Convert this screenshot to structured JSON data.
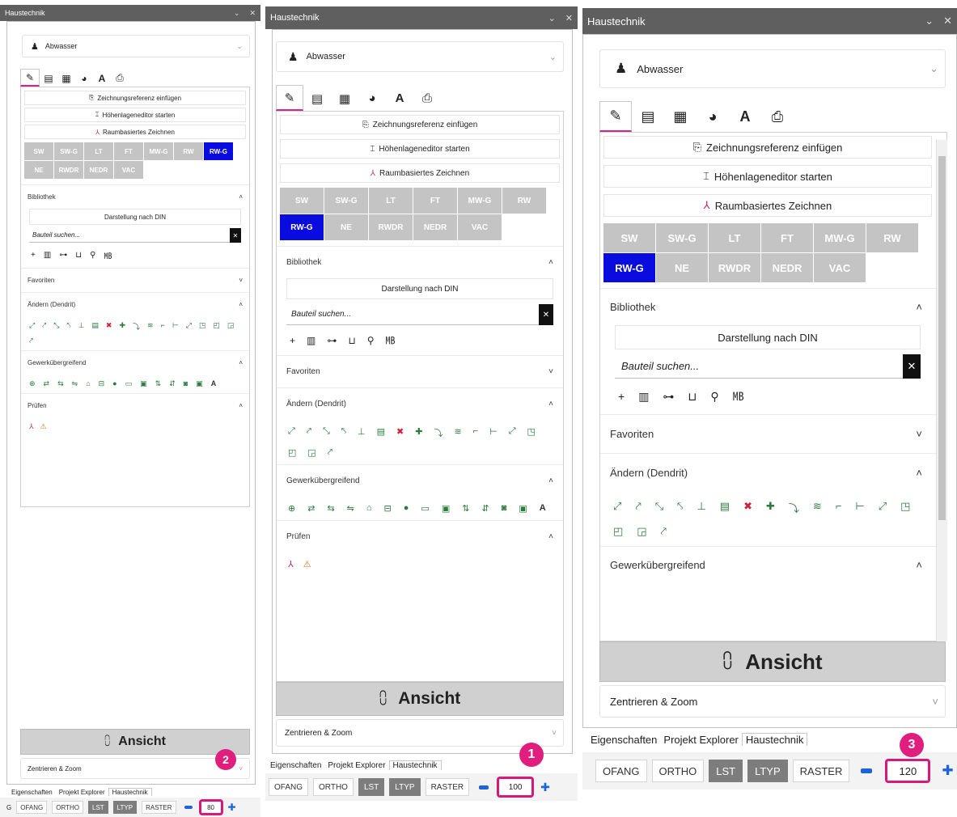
{
  "panel_title": "Haustechnik",
  "window_controls": {
    "chevron": "⌄",
    "close": "✕"
  },
  "system_dropdown": {
    "value": "Abwasser",
    "icon": "toilet-icon"
  },
  "tab_icons": [
    "pencil-icon",
    "list-icon",
    "calculator-icon",
    "pie-chart-icon",
    "text-style-icon",
    "print-icon"
  ],
  "actions": {
    "drawing_reference": "Zeichnungsreferenz einfügen",
    "height_editor": "Höhenlageneditor starten",
    "room_drawing": "Raumbasiertes Zeichnen"
  },
  "system_buttons_row1": [
    "SW",
    "SW-G",
    "LT",
    "FT",
    "MW-G",
    "RW"
  ],
  "system_buttons_row2": [
    "RW-G",
    "NE",
    "RWDR",
    "NEDR",
    "VAC"
  ],
  "selected_system": "RW-G",
  "sections": {
    "bibliothek": "Bibliothek",
    "favoriten": "Favoriten",
    "aendern": "Ändern (Dendrit)",
    "gewerk": "Gewerkübergreifend",
    "pruefen": "Prüfen"
  },
  "library": {
    "display_mode": "Darstellung nach DIN",
    "search_placeholder": "Bauteil suchen...",
    "clear_label": "✕"
  },
  "library_tools": [
    "+",
    "▥",
    "⊶",
    "⊔",
    "⚲",
    "㎆"
  ],
  "aendern_tools": [
    "⤢",
    "⤤",
    "⤡",
    "⤣",
    "⊥",
    "▤",
    "✖",
    "✚",
    "⤵",
    "≋",
    "⌐",
    "⊢",
    "⤢",
    "◳",
    "◰",
    "◲",
    "⤤",
    "⤡"
  ],
  "gewerk_tools": [
    "⊕",
    "⇄",
    "⇆",
    "⇋",
    "⌂",
    "⊟",
    "●",
    "▭",
    "▣",
    "⇅",
    "⇵",
    "◙",
    "▣",
    "A"
  ],
  "pruefen_tools": [
    "⅄",
    "⚠"
  ],
  "ansicht": {
    "label": "Ansicht",
    "icon": "chart-icon"
  },
  "zoom_section": "Zentrieren & Zoom",
  "bottom_tabs": [
    "Eigenschaften",
    "Projekt Explorer",
    "Haustechnik"
  ],
  "status_buttons": [
    "OFANG",
    "ORTHO",
    "LST",
    "LTYP",
    "RASTER"
  ],
  "status_prefix": "G",
  "zoom_values": [
    "80",
    "100",
    "120"
  ],
  "badges": [
    "2",
    "1",
    "3"
  ],
  "colors": {
    "accent": "#cc2a8a",
    "badge": "#e01e7e",
    "selected": "#0a0bde",
    "titlebar": "#5f5f5f",
    "grey_button": "#c4c4c4"
  }
}
